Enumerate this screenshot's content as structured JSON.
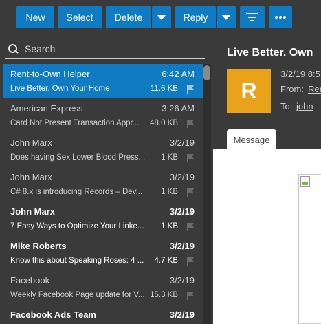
{
  "toolbar": {
    "new_label": "New",
    "select_label": "Select",
    "delete_label": "Delete",
    "reply_label": "Reply",
    "accent": "#0f7bc3"
  },
  "search": {
    "placeholder": "Search"
  },
  "messages": [
    {
      "from": "Rent-to-Own Helper",
      "time": "6:42 AM",
      "subject": "Live Better. Own Your Home",
      "size": "11.6 KB",
      "selected": true,
      "unread": false
    },
    {
      "from": "American Express",
      "time": "3:26 AM",
      "subject": "Card Not Present Transaction Appr...",
      "size": "48.0 KB",
      "selected": false,
      "unread": false
    },
    {
      "from": "John Marx",
      "time": "3/2/19",
      "subject": "Does having Sex Lower Blood Press...",
      "size": "1 KB",
      "selected": false,
      "unread": false
    },
    {
      "from": "John Marx",
      "time": "3/2/19",
      "subject": "C# 8.x is introducing Records – Dev...",
      "size": "1 KB",
      "selected": false,
      "unread": false
    },
    {
      "from": "John Marx",
      "time": "3/2/19",
      "subject": "7 Easy Ways to Optimize Your Linke...",
      "size": "1 KB",
      "selected": false,
      "unread": true
    },
    {
      "from": "Mike Roberts",
      "time": "3/2/19",
      "subject": "Know this about Speaking Roses: 4 ...",
      "size": "4.7 KB",
      "selected": false,
      "unread": true
    },
    {
      "from": "Facebook",
      "time": "3/2/19",
      "subject": "Weekly Facebook Page update for V...",
      "size": "15.3 KB",
      "selected": false,
      "unread": false
    },
    {
      "from": "Facebook Ads Team",
      "time": "3/2/19",
      "subject": "",
      "size": "",
      "selected": false,
      "unread": true
    }
  ],
  "reading": {
    "subject": "Live Better. Own",
    "avatar_letter": "R",
    "avatar_color": "#e8a31a",
    "date": "3/2/19 8:5",
    "from_label": "From:",
    "from_value": "Ren",
    "to_label": "To:",
    "to_value": "john",
    "tab_label": "Message"
  }
}
